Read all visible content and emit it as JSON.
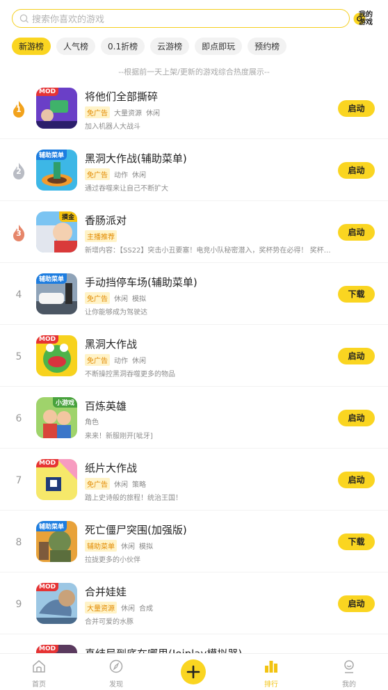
{
  "search": {
    "placeholder": "搜索你喜欢的游戏"
  },
  "my_game": {
    "label_line1": "我的",
    "label_line2": "游戏"
  },
  "tabs": [
    {
      "label": "新游榜",
      "active": true
    },
    {
      "label": "人气榜",
      "active": false
    },
    {
      "label": "0.1折榜",
      "active": false
    },
    {
      "label": "云游榜",
      "active": false
    },
    {
      "label": "即点即玩",
      "active": false
    },
    {
      "label": "预约榜",
      "active": false
    }
  ],
  "subnote": "--根据前一天上架/更新的游戏综合热度展示--",
  "games": [
    {
      "rank": "1",
      "title": "将他们全部撕碎",
      "badge": "MOD",
      "tags": [
        "免广告",
        "大量资源",
        "休闲"
      ],
      "desc": "加入机器人大战斗",
      "button": "启动"
    },
    {
      "rank": "2",
      "title": "黑洞大作战(辅助菜单)",
      "badge": "辅助菜单",
      "tags": [
        "免广告",
        "动作",
        "休闲"
      ],
      "desc": "通过吞噬来让自己不断扩大",
      "button": "启动"
    },
    {
      "rank": "3",
      "title": "香肠派对",
      "badge": "摸金",
      "tags": [
        "主播推荐"
      ],
      "desc": "新增内容：【SS22】突击小丑要塞！电竞小队秘密潜入，奖杯势在必得！ 奖杯被夺，…",
      "button": "启动"
    },
    {
      "rank": "4",
      "title": "手动挡停车场(辅助菜单)",
      "badge": "辅助菜单",
      "tags": [
        "免广告",
        "休闲",
        "模拟"
      ],
      "desc": "让你能够成为驾驶达",
      "button": "下载"
    },
    {
      "rank": "5",
      "title": "黑洞大作战",
      "badge": "MOD",
      "tags": [
        "免广告",
        "动作",
        "休闲"
      ],
      "desc": "不断操控黑洞吞噬更多的物品",
      "button": "启动"
    },
    {
      "rank": "6",
      "title": "百炼英雄",
      "badge": "小游戏",
      "tags": [
        "角色"
      ],
      "desc": "来来！新服刚开[呲牙]",
      "button": "启动"
    },
    {
      "rank": "7",
      "title": "纸片大作战",
      "badge": "MOD",
      "tags": [
        "免广告",
        "休闲",
        "策略"
      ],
      "desc": "踏上史诗般的旅程！统治王国！",
      "button": "启动"
    },
    {
      "rank": "8",
      "title": "死亡僵尸突围(加强版)",
      "badge": "辅助菜单",
      "tags": [
        "辅助菜单",
        "休闲",
        "模拟"
      ],
      "desc": "拉拢更多的小伙伴",
      "button": "下载"
    },
    {
      "rank": "9",
      "title": "合并娃娃",
      "badge": "MOD",
      "tags": [
        "大量资源",
        "休闲",
        "合成"
      ],
      "desc": "合并可爱的水豚",
      "button": "启动"
    },
    {
      "rank": "",
      "title": "真结局到底在哪里(Joiplay模拟器)",
      "badge": "MOD",
      "tags": [],
      "desc": "",
      "button": ""
    }
  ],
  "bottom_nav": [
    {
      "label": "首页",
      "icon": "home-icon",
      "active": false
    },
    {
      "label": "发现",
      "icon": "compass-icon",
      "active": false
    },
    {
      "label": "",
      "icon": "plus-icon",
      "active": false
    },
    {
      "label": "排行",
      "icon": "rank-icon",
      "active": true
    },
    {
      "label": "我的",
      "icon": "profile-icon",
      "active": false
    }
  ],
  "colors": {
    "accent": "#fad521",
    "tag_bg": "#fff3c8",
    "tag_text": "#e28a00",
    "mod_badge": "#e63334"
  }
}
